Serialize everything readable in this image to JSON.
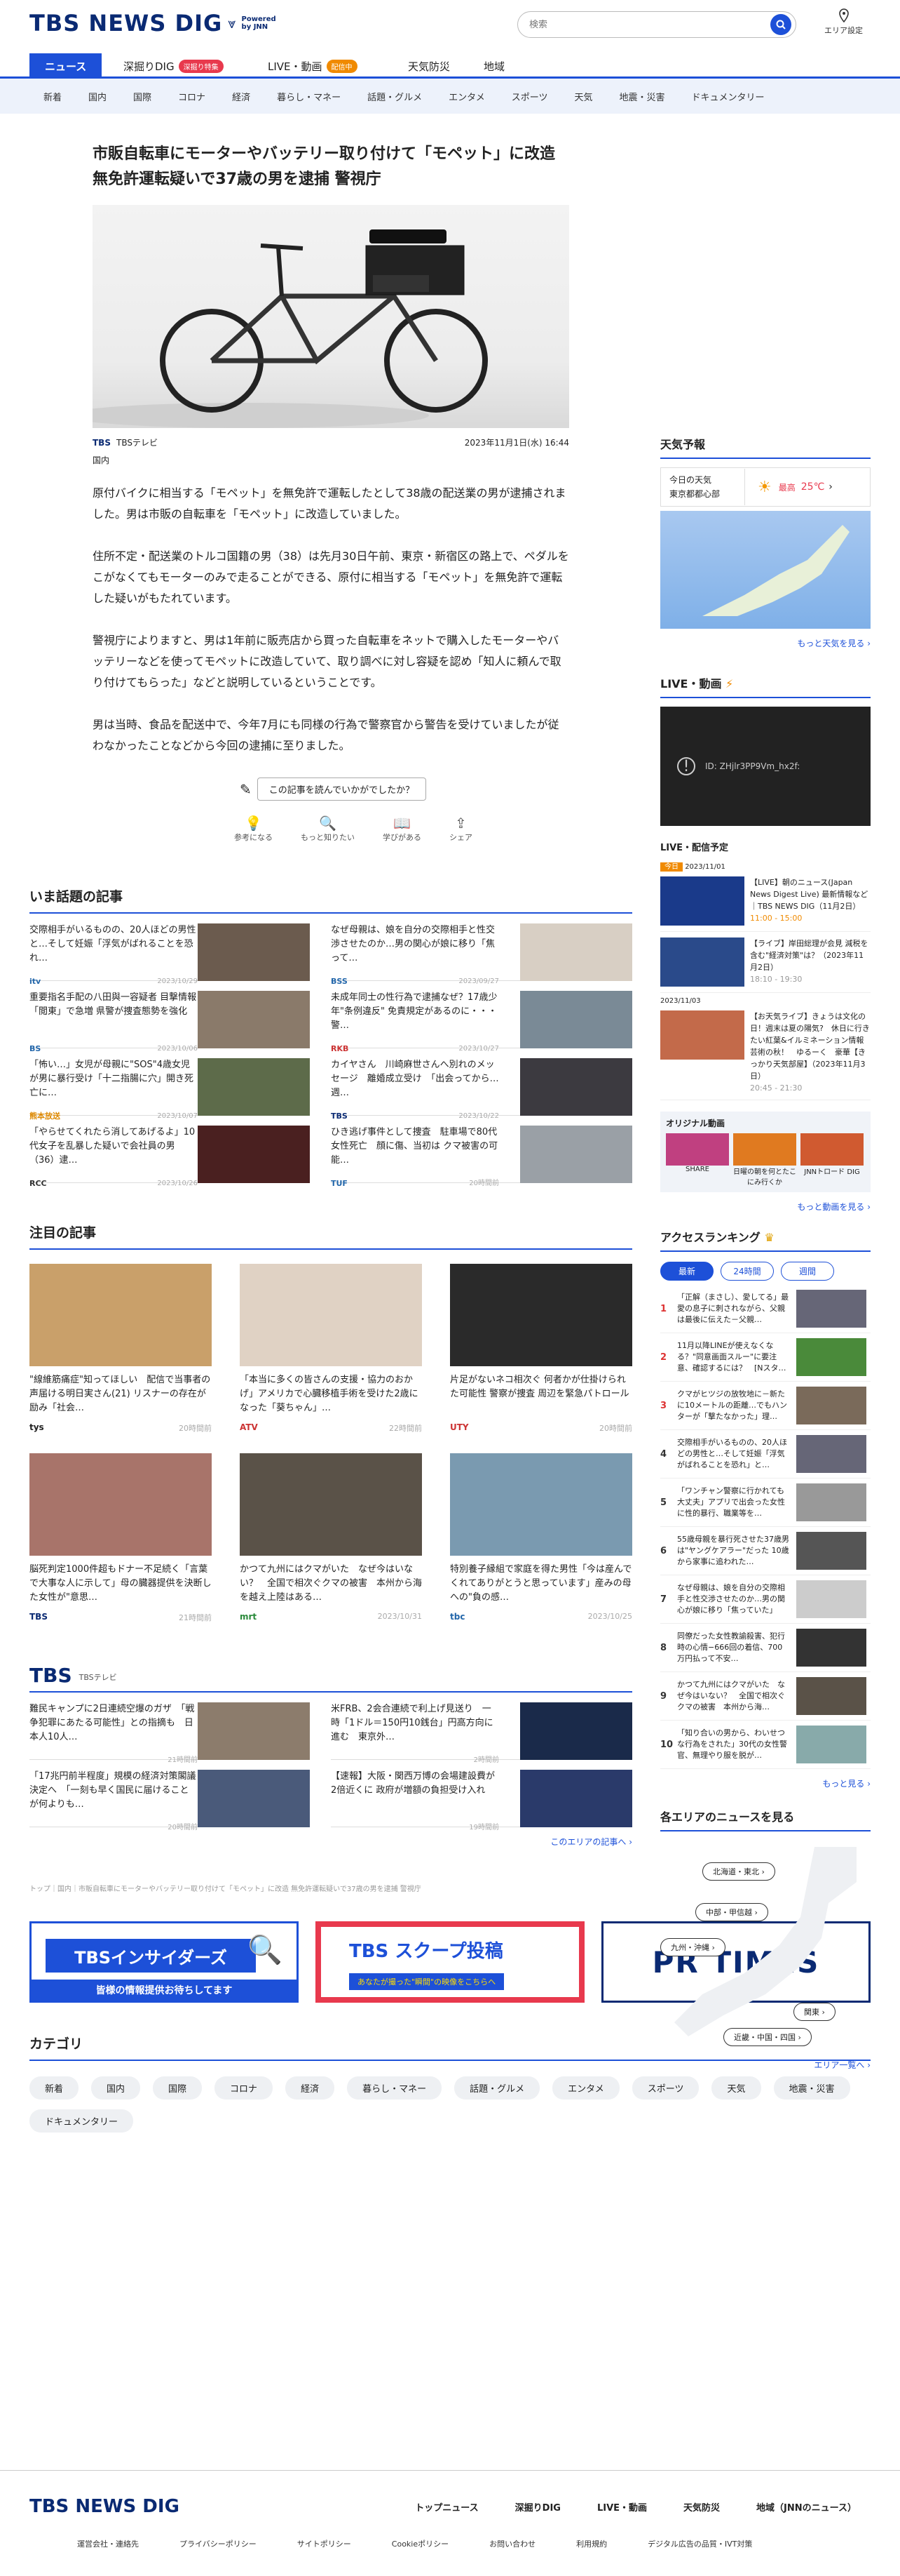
{
  "header": {
    "logo": "TBS NEWS DIG",
    "powered": "Powered by JNN",
    "search_placeholder": "検索",
    "area_label": "エリア設定"
  },
  "tabs": [
    {
      "label": "ニュース"
    },
    {
      "label": "深掘りDIG",
      "badge": "深掘り特集"
    },
    {
      "label": "LIVE・動画",
      "badge": "配信中"
    },
    {
      "label": "天気防災"
    },
    {
      "label": "地域"
    }
  ],
  "subnav": [
    "新着",
    "国内",
    "国際",
    "コロナ",
    "経済",
    "暮らし・マネー",
    "話題・グルメ",
    "エンタメ",
    "スポーツ",
    "天気",
    "地震・災害",
    "ドキュメンタリー"
  ],
  "article": {
    "title": "市販自転車にモーターやバッテリー取り付けて「モペット」に改造 無免許運転疑いで37歳の男を逮捕 警視庁",
    "source": "TBSテレビ",
    "category": "国内",
    "date": "2023年11月1日(水) 16:44",
    "paragraphs": [
      "原付バイクに相当する「モペット」を無免許で運転したとして38歳の配送業の男が逮捕されました。男は市販の自転車を「モペット」に改造していました。",
      "住所不定・配送業のトルコ国籍の男（38）は先月30日午前、東京・新宿区の路上で、ペダルをこがなくてもモーターのみで走ることができる、原付に相当する「モペット」を無免許で運転した疑いがもたれています。",
      "警視庁によりますと、男は1年前に販売店から買った自転車をネットで購入したモーターやバッテリーなどを使ってモペットに改造していて、取り調べに対し容疑を認め「知人に頼んで取り付けてもらった」などと説明しているということです。",
      "男は当時、食品を配送中で、今年7月にも同様の行為で警察官から警告を受けていましたが従わなかったことなどから今回の逮捕に至りました。"
    ],
    "survey": "この記事を読んでいかがでしたか？",
    "reactions": [
      "参考になる",
      "もっと知りたい",
      "学びがある",
      "シェア"
    ]
  },
  "popular": {
    "title": "いま話題の記事",
    "items": [
      {
        "text": "交際相手がいるものの、20人ほどの男性と…そして妊娠「浮気がばれることを恐れ…",
        "src": "itv",
        "date": "2023/10/29"
      },
      {
        "text": "なぜ母親は、娘を自分の交際相手と性交渉させたのか…男の関心が娘に移り「焦って…",
        "src": "BSS",
        "date": "2023/09/27"
      },
      {
        "text": "重要指名手配の八田與一容疑者 目撃情報「閲東」で急増 県警が捜査態勢を強化",
        "src": "BS",
        "date": "2023/10/06"
      },
      {
        "text": "未成年同士の性行為で逮捕なぜ？17歳少年\"条例違反\" 免責規定があるのに・・・警…",
        "src": "RKB",
        "date": "2023/10/27"
      },
      {
        "text": "「怖い…」女児が母親に\"SOS\"4歳女児が男に暴行受け「十二指腸に穴」開き死亡に…",
        "src": "熊本放送",
        "date": "2023/10/07"
      },
      {
        "text": "カイヤさん　川崎麻世さんへ別れのメッセージ　離婚成立受け　「出会ってから…週…",
        "src": "TBS",
        "date": "2023/10/22"
      },
      {
        "text": "「やらせてくれたら消してあげるよ」10代女子を乱暴した疑いで会社員の男（36）逮…",
        "src": "RCC",
        "date": "2023/10/26"
      },
      {
        "text": "ひき逃げ事件として捜査　駐車場で80代女性死亡　顔に傷、当初は クマ被害の可能…",
        "src": "TUF",
        "date": "20時間前"
      }
    ]
  },
  "featured": {
    "title": "注目の記事",
    "items": [
      {
        "text": "\"線維筋痛症\"知ってほしい　配信で当事者の声届ける明日実さん(21) リスナーの存在が励み「社会…",
        "src": "tys",
        "date": "20時間前"
      },
      {
        "text": "「本当に多くの皆さんの支援・協力のおかげ」アメリカで心臓移植手術を受けた2歳になった「葵ちゃん」…",
        "src": "ATV",
        "date": "22時間前"
      },
      {
        "text": "片足がないネコ相次ぐ 何者かが仕掛けられた可能性 警察が捜査 周辺を緊急パトロール",
        "src": "UTY",
        "date": "20時間前"
      },
      {
        "text": "脳死判定1000件超もドナー不足続く「言葉で大事な人に示して」母の臓器提供を決断した女性が\"意思…",
        "src": "TBS",
        "date": "21時間前"
      },
      {
        "text": "かつて九州にはクマがいた　なぜ今はいない？　全国で相次ぐクマの被害　本州から海を越え上陸はある…",
        "src": "mrt",
        "date": "2023/10/31"
      },
      {
        "text": "特別養子縁組で家庭を得た男性「今は産んでくれてありがとうと思っています」産みの母への\"負の感…",
        "src": "tbc",
        "date": "2023/10/25"
      }
    ]
  },
  "tbsbox": {
    "logo": "TBS",
    "subtitle": "TBSテレビ",
    "items": [
      {
        "text": "難民キャンプに2日連続空爆のガザ　「戦争犯罪にあたる可能性」との指摘も　日本人10人…",
        "date": "21時間前"
      },
      {
        "text": "米FRB、2会合連続で利上げ見送り　一時「1ドル＝150円10銭台」円高方向に進む　東京外…",
        "date": "2時間前"
      },
      {
        "text": "「17兆円前半程度」規模の経済対策閣議決定へ　「一刻も早く国民に届けることが何よりも…",
        "date": "20時間前"
      },
      {
        "text": "【速報】大阪・関西万博の会場建設費が2倍近くに 政府が増額の負担受け入れ",
        "date": "19時間前"
      }
    ],
    "more": "このエリアの記事へ ›"
  },
  "breadcrumb": "トップ｜国内｜市販自転車にモーターやバッテリー取り付けて「モペット」に改造 無免許運転疑いで37歳の男を逮捕 警視庁",
  "banners": [
    {
      "title": "TBSインサイダーズ",
      "sub": "皆様の情報提供お待ちしてます"
    },
    {
      "title": "TBS スクープ投稿",
      "sub": "あなたが撮った\"瞬間\"の映像をこちらへ"
    },
    {
      "title": "PR TIMES",
      "sub": ""
    }
  ],
  "categories": {
    "title": "カテゴリ",
    "items": [
      "新着",
      "国内",
      "国際",
      "コロナ",
      "経済",
      "暮らし・マネー",
      "話題・グルメ",
      "エンタメ",
      "スポーツ",
      "天気",
      "地震・災害",
      "ドキュメンタリー"
    ]
  },
  "sidebar": {
    "weather_title": "天気予報",
    "weather_today": "今日の天気",
    "weather_place": "東京都都心部",
    "weather_label": "最高",
    "weather_temp": "25℃",
    "weather_more": "もっと天気を見る ›",
    "live_title": "LIVE・動画",
    "live_error": "ID: ZHjlr3PP9Vm_hx2f:",
    "schedule_title": "LIVE・配信予定",
    "schedule": [
      {
        "tag": "今日",
        "date": "2023/11/01",
        "text": "【LIVE】朝のニュース(Japan News Digest Live) 最新情報など｜TBS NEWS DIG（11月2日）",
        "time": "11:00 - 15:00"
      },
      {
        "tag": "今日",
        "date": "",
        "text": "【ライブ】岸田総理が会見 減税を含む\"経済対策\"は？（2023年11月2日）",
        "time": "18:10 - 19:30"
      },
      {
        "tag": "",
        "date": "2023/11/03",
        "text": "【お天気ライブ】きょうは文化の日！週末は夏の陽気?　休日に行きたい紅葉&イルミネーション情報　芸術の秋！　ゆるーく　豪華【きっかり天気部屋】（2023年11月3日）",
        "time": "20:45 - 21:30"
      }
    ],
    "original_title": "オリジナル動画",
    "originals": [
      "SHARE",
      "日曜の朝を何とたこにみ行くか",
      "JNNトロード DIG"
    ],
    "videos_more": "もっと動画を見る ›",
    "ranking_title": "アクセスランキング",
    "ranking_tabs": [
      "最新",
      "24時間",
      "週間"
    ],
    "ranking": [
      "「正解（まさし）、愛してる」最愛の息子に刺されながら、父親は最後に伝えた－父親…",
      "11月以降LINEが使えなくなる？\"同意画面スルー\"に要注意、確認するには？　[Nスタ…",
      "クマがヒツジの放牧地に－新たに10メートルの距離…でもハンターが「撃たなかった」理…",
      "交際相手がいるものの、20人ほどの男性と…そして妊娠「浮気がばれることを恐れ」と…",
      "「ワンチャン警察に行かれても大丈夫」アプリで出会った女性に性的暴行、職業等を…",
      "55歳母親を暴行死させた37歳男は\"ヤングケアラー\"だった 10歳から家事に追われた…",
      "なぜ母親は、娘を自分の交際相手と性交渉させたのか…男の関心が娘に移り「焦っていた」",
      "同僚だった女性教諭殺害、犯行時の心情−666回の着信、700万円払って不安…",
      "かつて九州にはクマがいた　なぜ今はいない？　全国で相次ぐクマの被害　本州から海…",
      "「知り合いの男から、わいせつな行為をされた」30代の女性警官、無理やり服を脱が…"
    ],
    "ranking_more": "もっと見る ›",
    "area_title": "各エリアのニュースを見る",
    "areas": [
      "北海道・東北 ›",
      "中部・甲信越 ›",
      "九州・沖縄 ›",
      "関東 ›",
      "近畿・中国・四国 ›"
    ],
    "area_more": "エリア一覧へ ›"
  },
  "footer": {
    "logo": "TBS NEWS DIG",
    "links": [
      "トップニュース",
      "深掘りDIG",
      "LIVE・動画",
      "天気防災",
      "地域（JNNのニュース）"
    ],
    "sub": [
      "運営会社・連絡先",
      "プライバシーポリシー",
      "サイトポリシー",
      "Cookieポリシー",
      "お問い合わせ",
      "利用規約",
      "デジタル広告の品質・IVT対策"
    ]
  },
  "colors": {
    "accent": "#1d50d8",
    "live": "#f08a00",
    "badge": "#e8394d"
  }
}
